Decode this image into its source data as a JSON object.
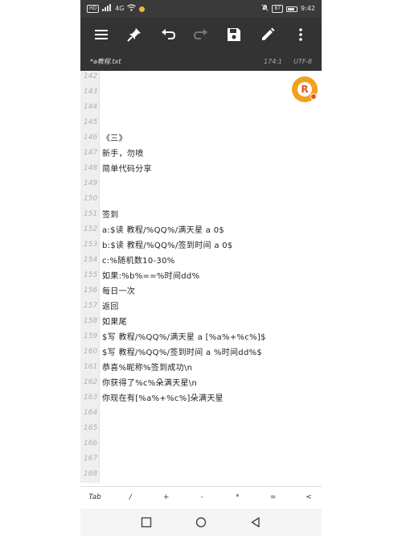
{
  "status_bar": {
    "signal_text": "HD",
    "network_text": "4G",
    "battery_text": "87",
    "time": "9:42",
    "icons": [
      "hd-icon",
      "signal-icon",
      "wifi-icon",
      "notification-icon",
      "mute-icon",
      "battery-icon"
    ]
  },
  "toolbar": {
    "icons": [
      "menu-icon",
      "pin-icon",
      "undo-icon",
      "redo-icon",
      "save-icon",
      "edit-icon",
      "more-icon"
    ]
  },
  "file": {
    "name": "*a教程.txt",
    "position": "174:1",
    "encoding": "UTF-8"
  },
  "lines": [
    {
      "n": "142",
      "text": ""
    },
    {
      "n": "143",
      "text": ""
    },
    {
      "n": "144",
      "text": ""
    },
    {
      "n": "145",
      "text": ""
    },
    {
      "n": "146",
      "text": "《三》"
    },
    {
      "n": "147",
      "text": "新手，勿喷"
    },
    {
      "n": "148",
      "text": "简单代码分享"
    },
    {
      "n": "149",
      "text": ""
    },
    {
      "n": "150",
      "text": ""
    },
    {
      "n": "151",
      "text": "签到"
    },
    {
      "n": "152",
      "text": "a:$读 教程/%QQ%/满天星 a 0$"
    },
    {
      "n": "153",
      "text": "b:$读 教程/%QQ%/签到时间 a 0$"
    },
    {
      "n": "154",
      "text": "c:%随机数10-30%"
    },
    {
      "n": "155",
      "text": "如果:%b%==%时间dd%"
    },
    {
      "n": "156",
      "text": "每日一次"
    },
    {
      "n": "157",
      "text": "返回"
    },
    {
      "n": "158",
      "text": "如果尾"
    },
    {
      "n": "159",
      "text": "$写 教程/%QQ%/满天星 a [%a%+%c%]$"
    },
    {
      "n": "160",
      "text": "$写 教程/%QQ%/签到时间 a %时间dd%$"
    },
    {
      "n": "161",
      "text": "恭喜%昵称%签到成功\\n"
    },
    {
      "n": "162",
      "text": "你获得了%c%朵满天星\\n"
    },
    {
      "n": "163",
      "text": "你现在有[%a%+%c%]朵满天星"
    },
    {
      "n": "164",
      "text": ""
    },
    {
      "n": "165",
      "text": ""
    },
    {
      "n": "166",
      "text": ""
    },
    {
      "n": "167",
      "text": ""
    },
    {
      "n": "168",
      "text": ""
    }
  ],
  "fab": {
    "letter": "R"
  },
  "symbols": [
    "Tab",
    "/",
    "+",
    "-",
    "*",
    "=",
    "<"
  ],
  "nav": [
    "recent-apps-icon",
    "home-icon",
    "back-icon"
  ]
}
